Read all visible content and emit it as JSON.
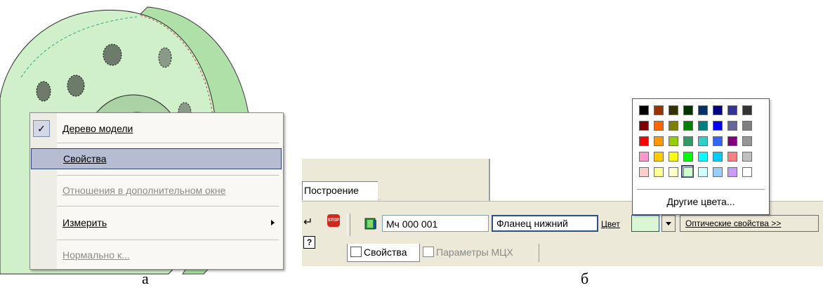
{
  "context_menu": {
    "items": [
      {
        "label": "Дерево модели",
        "checked": true,
        "enabled": true
      },
      {
        "label": "Свойства",
        "selected": true,
        "enabled": true
      },
      {
        "label": "Отношения в дополнительном окне",
        "enabled": false
      },
      {
        "label": "Измерить",
        "has_submenu": true,
        "enabled": true
      },
      {
        "label": "Нормально к...",
        "enabled": false
      }
    ]
  },
  "captions": {
    "left": "а",
    "right": "б"
  },
  "panel": {
    "build_tab": "Построение",
    "designation": "Мч 000 001",
    "name": "Фланец нижний",
    "color_label": "Цвет",
    "current_color": "#d9f7d3",
    "optical_button": "Оптические свойства  >>",
    "tabs": [
      {
        "label": "Свойства",
        "active": true
      },
      {
        "label": "Параметры МЦХ",
        "active": false
      }
    ],
    "stop_icon_text": "STOP"
  },
  "color_popup": {
    "rows": [
      [
        "#000000",
        "#993300",
        "#333300",
        "#003300",
        "#003366",
        "#000080",
        "#333399",
        "#333333"
      ],
      [
        "#800000",
        "#ff6600",
        "#808000",
        "#008000",
        "#008080",
        "#0000ff",
        "#666699",
        "#808080"
      ],
      [
        "#ff0000",
        "#ff9900",
        "#99cc00",
        "#339966",
        "#33cccc",
        "#3366ff",
        "#800080",
        "#969696"
      ],
      [
        "#ff99cc",
        "#ffcc00",
        "#ffff00",
        "#00ff00",
        "#00ffff",
        "#00ccff",
        "#ff8080",
        "#c0c0c0"
      ],
      [
        "#ffcccc",
        "#ffff99",
        "#ffffcc",
        "#ccffcc",
        "#ccffff",
        "#99ccff",
        "#cc99ff",
        "#ffffff"
      ]
    ],
    "selected_index": [
      4,
      3
    ],
    "more_colors": "Другие цвета..."
  }
}
